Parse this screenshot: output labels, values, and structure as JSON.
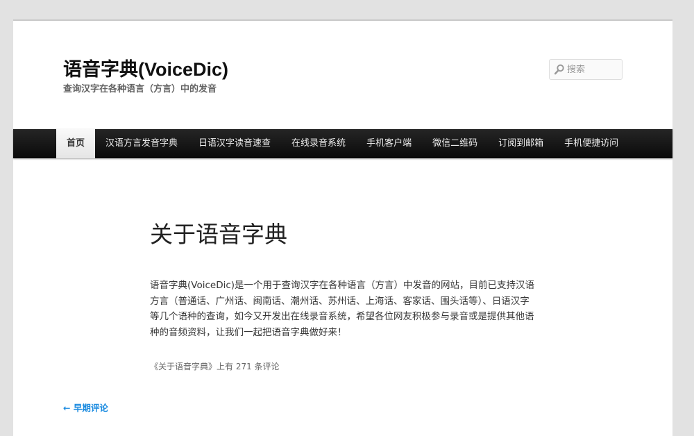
{
  "header": {
    "site_title": "语音字典(VoiceDic)",
    "site_description": "查询汉字在各种语言（方言）中的发音"
  },
  "search": {
    "placeholder": "搜索",
    "icon": "search-icon"
  },
  "nav": {
    "items": [
      {
        "label": "首页",
        "current": true
      },
      {
        "label": "汉语方言发音字典"
      },
      {
        "label": "日语汉字读音速查"
      },
      {
        "label": "在线录音系统"
      },
      {
        "label": "手机客户端"
      },
      {
        "label": "微信二维码"
      },
      {
        "label": "订阅到邮箱"
      },
      {
        "label": "手机便捷访问"
      }
    ]
  },
  "article": {
    "title": "关于语音字典",
    "body": "语音字典(VoiceDic)是一个用于查询汉字在各种语言（方言）中发音的网站，目前已支持汉语方言（普通话、广州话、闽南话、潮州话、苏州话、上海话、客家话、围头话等）、日语汉字等几个语种的查询，如今又开发出在线录音系统，希望各位网友积极参与录音或是提供其他语种的音频资料，让我们一起把语音字典做好来！",
    "comments_meta": "《关于语音字典》上有 271 条评论"
  },
  "pagination": {
    "previous": "← 早期评论"
  },
  "colors": {
    "nav_background": "#111111",
    "link": "#1b8be0",
    "page_background": "#ffffff",
    "outer_background": "#e2e2e2"
  }
}
